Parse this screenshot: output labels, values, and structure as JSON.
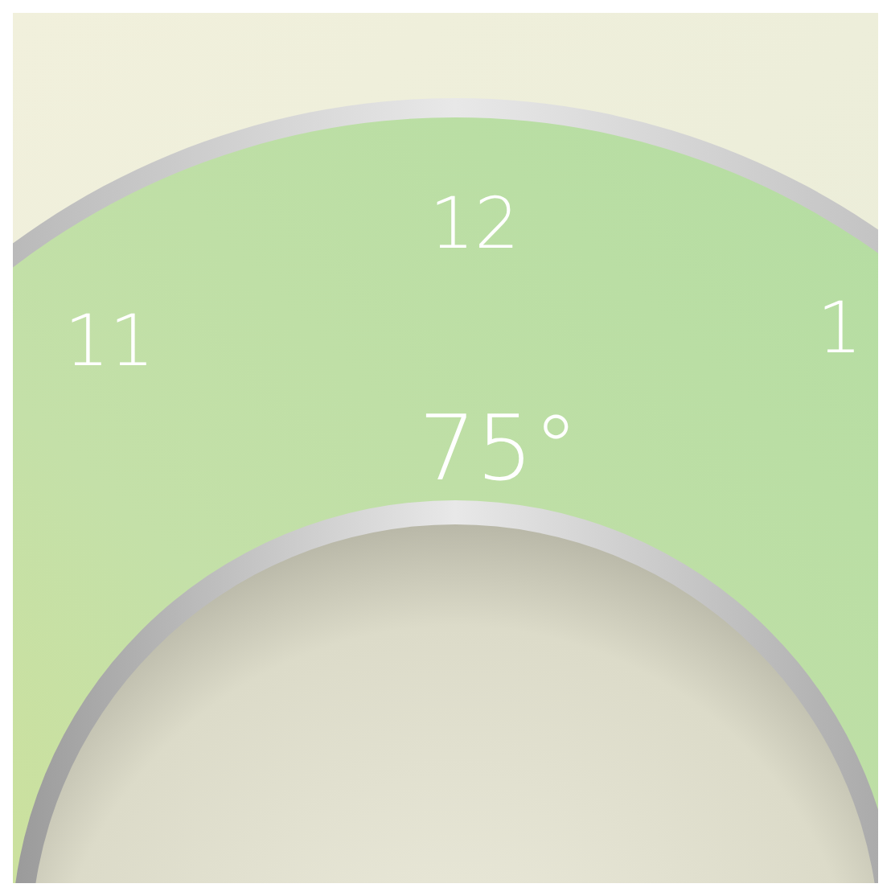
{
  "dial": {
    "hour_labels": [
      "11",
      "12",
      "1"
    ],
    "temperature": "75°"
  }
}
